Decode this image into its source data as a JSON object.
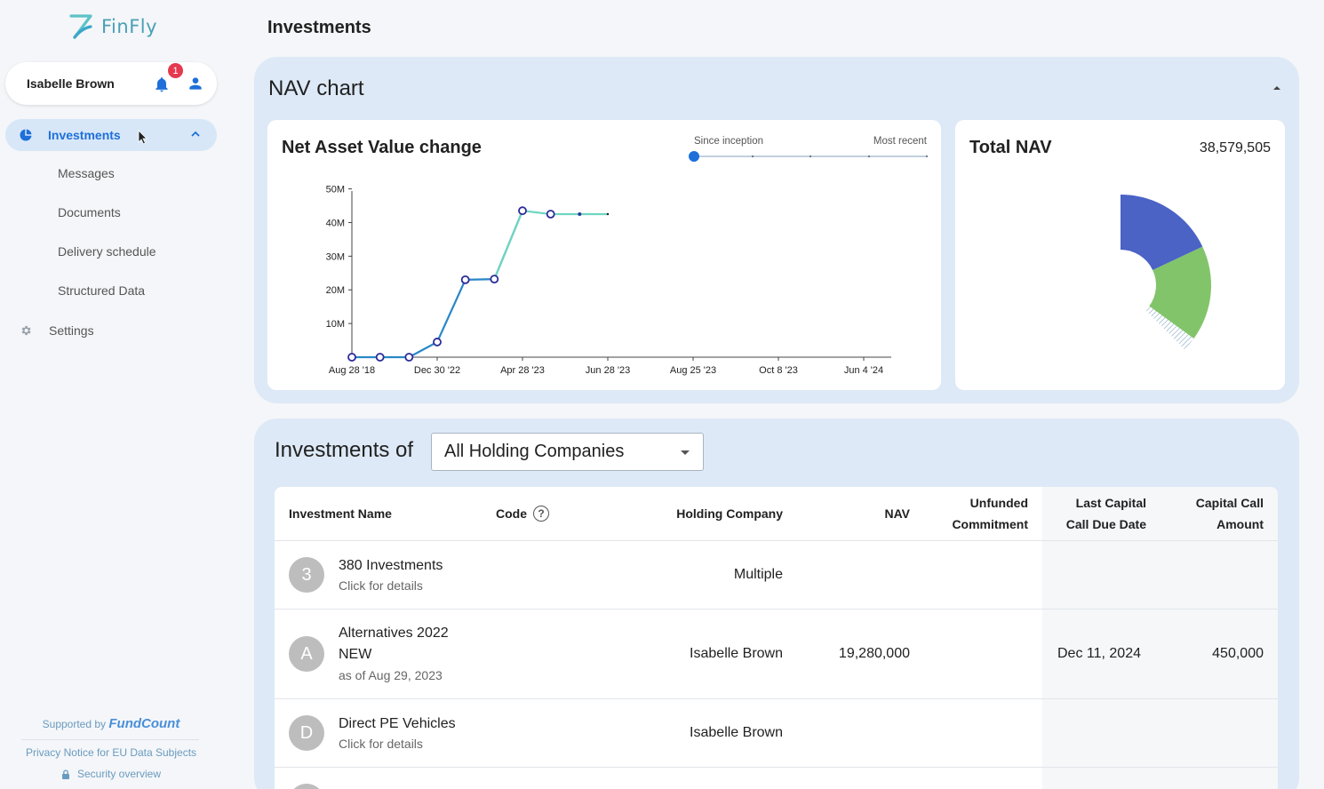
{
  "app": {
    "logo_text": "FinFly"
  },
  "user": {
    "name": "Isabelle Brown",
    "notifications": "1"
  },
  "sidebar": {
    "active_item": "Investments",
    "subitems": [
      "Messages",
      "Documents",
      "Delivery schedule",
      "Structured Data"
    ],
    "settings": "Settings",
    "supported_by": "Supported by",
    "supported_brand": "FundCount",
    "privacy": "Privacy Notice for EU Data Subjects",
    "security": "Security overview"
  },
  "page": {
    "title": "Investments"
  },
  "nav_panel": {
    "title": "NAV chart",
    "chart_title": "Net Asset Value change",
    "slider_left": "Since inception",
    "slider_right": "Most recent",
    "total_title": "Total NAV",
    "total_value": "38,579,505"
  },
  "chart_data": [
    {
      "type": "line",
      "title": "Net Asset Value change",
      "x_ticks": [
        "Aug 28 '18",
        "Dec 30 '22",
        "Apr 28 '23",
        "Jun 28 '23",
        "Aug 25 '23",
        "Oct 8 '23",
        "Jun 4 '24"
      ],
      "y_ticks": [
        "10M",
        "20M",
        "30M",
        "40M",
        "50M"
      ],
      "ylim": [
        0,
        52000000
      ],
      "series": [
        {
          "color": "#2a87c8",
          "x_index": [
            0,
            0.33,
            0.67,
            1.0,
            1.33,
            1.67,
            2.0
          ],
          "values": [
            0,
            0,
            0,
            4500000,
            23000000,
            23200000,
            43500000
          ]
        },
        {
          "color": "#6fd6c0",
          "x_index": [
            1.67,
            2.0,
            2.33,
            2.67,
            3.0
          ],
          "values": [
            23200000,
            43500000,
            42500000,
            42500000,
            42500000
          ]
        }
      ],
      "markers": [
        {
          "x_index": 0,
          "value": 0
        },
        {
          "x_index": 0.33,
          "value": 0
        },
        {
          "x_index": 0.67,
          "value": 0
        },
        {
          "x_index": 1.0,
          "value": 4500000
        },
        {
          "x_index": 1.33,
          "value": 23000000
        },
        {
          "x_index": 1.67,
          "value": 23200000
        },
        {
          "x_index": 2.0,
          "value": 43500000
        },
        {
          "x_index": 2.33,
          "value": 42500000
        },
        {
          "x_index": 2.67,
          "value": 42500000,
          "small": true
        },
        {
          "x_index": 3.0,
          "value": 42500000,
          "dot": true
        }
      ]
    },
    {
      "type": "pie",
      "title": "Total NAV",
      "slices": [
        {
          "share": 0.18,
          "color": "#4a63c5"
        },
        {
          "share": 0.17,
          "color": "#82c46a"
        },
        {
          "share": 0.025,
          "color": "#6e99b8",
          "hatched": true
        }
      ]
    }
  ],
  "investments": {
    "title": "Investments of",
    "filter": "All Holding Companies",
    "columns": {
      "name": "Investment Name",
      "code": "Code",
      "holding": "Holding Company",
      "nav": "NAV",
      "unfunded_1": "Unfunded",
      "unfunded_2": "Commitment",
      "last_call_1": "Last Capital",
      "last_call_2": "Call Due Date",
      "call_amount_1": "Capital Call",
      "call_amount_2": "Amount"
    },
    "rows": [
      {
        "avatar": "3",
        "name": "380 Investments",
        "sub": "Click for details",
        "holding": "Multiple",
        "nav": "",
        "due": "",
        "amount": ""
      },
      {
        "avatar": "A",
        "name": "Alternatives 2022",
        "name2": "NEW",
        "sub": "as of Aug 29, 2023",
        "holding": "Isabelle Brown",
        "nav": "19,280,000",
        "due": "Dec 11, 2024",
        "amount": "450,000"
      },
      {
        "avatar": "D",
        "name": "Direct PE Vehicles",
        "sub": "Click for details",
        "holding": "Isabelle Brown",
        "nav": "",
        "due": "",
        "amount": ""
      }
    ]
  }
}
